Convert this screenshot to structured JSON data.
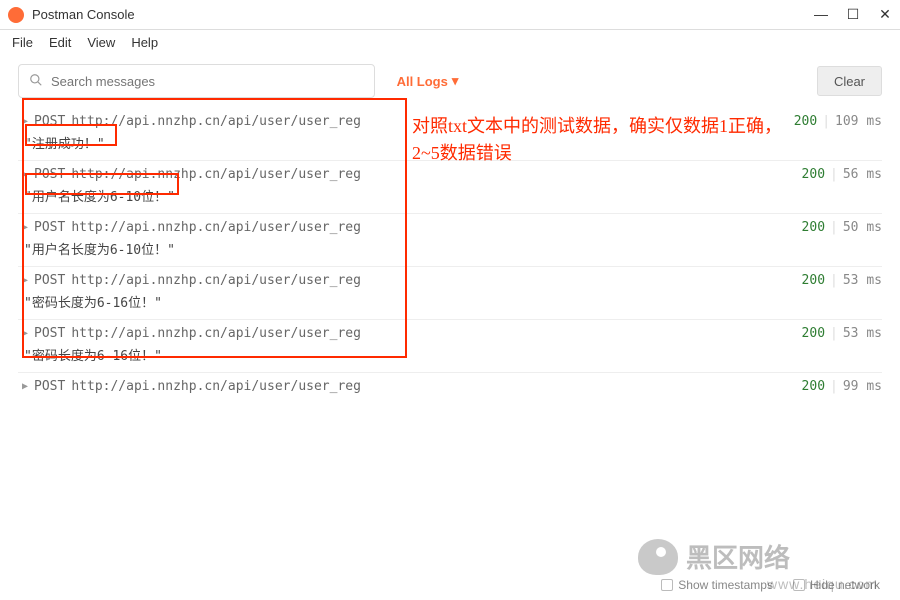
{
  "window": {
    "title": "Postman Console",
    "min_icon": "—",
    "max_icon": "☐",
    "close_icon": "✕"
  },
  "menu": {
    "file": "File",
    "edit": "Edit",
    "view": "View",
    "help": "Help"
  },
  "toolbar": {
    "search_placeholder": "Search messages",
    "filter_label": "All Logs",
    "filter_caret": "▾",
    "clear_label": "Clear"
  },
  "annotation": {
    "line1": "对照txt文本中的测试数据，确实仅数据1正确，",
    "line2": "2~5数据错误"
  },
  "entries": [
    {
      "method": "POST",
      "url": "http://api.nnzhp.cn/api/user/user_reg",
      "status": "200",
      "time": "109 ms",
      "msg": "\"注册成功！\""
    },
    {
      "method": "POST",
      "url": "http://api.nnzhp.cn/api/user/user_reg",
      "status": "200",
      "time": "56 ms",
      "msg": "\"用户名长度为6-10位！\""
    },
    {
      "method": "POST",
      "url": "http://api.nnzhp.cn/api/user/user_reg",
      "status": "200",
      "time": "50 ms",
      "msg": "\"用户名长度为6-10位！\""
    },
    {
      "method": "POST",
      "url": "http://api.nnzhp.cn/api/user/user_reg",
      "status": "200",
      "time": "53 ms",
      "msg": "\"密码长度为6-16位！\""
    },
    {
      "method": "POST",
      "url": "http://api.nnzhp.cn/api/user/user_reg",
      "status": "200",
      "time": "53 ms",
      "msg": "\"密码长度为6-16位！\""
    },
    {
      "method": "POST",
      "url": "http://api.nnzhp.cn/api/user/user_reg",
      "status": "200",
      "time": "99 ms",
      "msg": null
    }
  ],
  "footer": {
    "show_ts": "Show timestamps",
    "hide_net": "Hide network"
  },
  "watermark": {
    "text": "黑区网络",
    "url": "www.heiqu.com"
  }
}
